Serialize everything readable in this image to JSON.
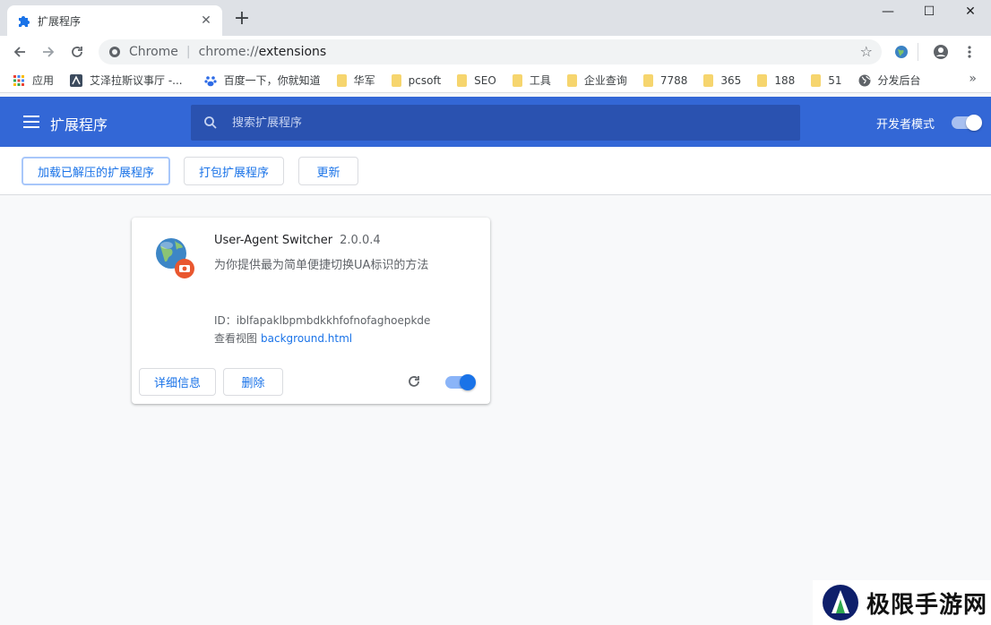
{
  "tab": {
    "title": "扩展程序",
    "icon": "puzzle-icon"
  },
  "window_controls": {
    "minimize": "—",
    "maximize": "☐",
    "close": "✕"
  },
  "omnibox": {
    "site": "Chrome",
    "scheme": "chrome://",
    "path": "extensions"
  },
  "bookmarks": [
    {
      "label": "应用",
      "icon": "apps-grid-icon"
    },
    {
      "label": "艾泽拉斯议事厅 -...",
      "icon": "site-icon"
    },
    {
      "label": "百度一下，你就知道",
      "icon": "baidu-paw-icon"
    },
    {
      "label": "华军",
      "icon": "folder-icon"
    },
    {
      "label": "pcsoft",
      "icon": "folder-icon"
    },
    {
      "label": "SEO",
      "icon": "folder-icon"
    },
    {
      "label": "工具",
      "icon": "folder-icon"
    },
    {
      "label": "企业查询",
      "icon": "folder-icon"
    },
    {
      "label": "7788",
      "icon": "folder-icon"
    },
    {
      "label": "365",
      "icon": "folder-icon"
    },
    {
      "label": "188",
      "icon": "folder-icon"
    },
    {
      "label": "51",
      "icon": "folder-icon"
    },
    {
      "label": "分发后台",
      "icon": "globe-icon"
    }
  ],
  "bookmarks_more": "»",
  "header": {
    "title": "扩展程序",
    "search_placeholder": "搜索扩展程序",
    "dev_mode_label": "开发者模式"
  },
  "actions": {
    "load_unpacked": "加载已解压的扩展程序",
    "pack": "打包扩展程序",
    "update": "更新"
  },
  "extension": {
    "name": "User-Agent Switcher",
    "version": "2.0.0.4",
    "description": "为你提供最为简单便捷切换UA标识的方法",
    "id_text": "ID：iblfapaklbpmbdkkhfofnofaghoepkde",
    "views_label": "查看视图",
    "views_link": "background.html",
    "details_label": "详细信息",
    "remove_label": "删除",
    "enabled": true
  },
  "watermark": {
    "text": "极限手游网"
  },
  "colors": {
    "header_blue": "#3367d6",
    "search_blue": "#2a52b0",
    "accent": "#1a73e8"
  }
}
